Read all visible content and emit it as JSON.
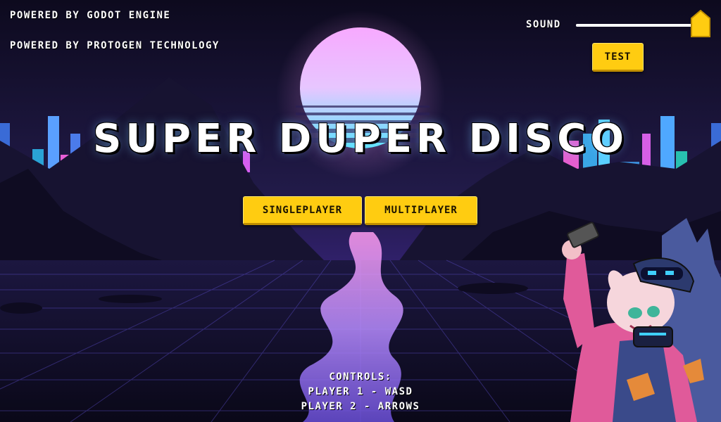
{
  "credits": {
    "line1": "POWERED BY GODOT ENGINE",
    "line2": "POWERED BY PROTOGEN TECHNOLOGY"
  },
  "sound": {
    "label": "SOUND",
    "level": 1.0,
    "test_label": "TEST"
  },
  "title": "SUPER DUPER DISCO",
  "menu": {
    "singleplayer_label": "SINGLEPLAYER",
    "multiplayer_label": "MULTIPLAYER"
  },
  "controls": {
    "title": "CONTROLS:",
    "player1": "PLAYER 1 - WASD",
    "player2": "PLAYER 2 - ARROWS"
  },
  "colors": {
    "button": "#ffcc11",
    "sun_top": "#f4a6ff",
    "sun_bottom": "#5ee6ff",
    "grid": "#6a5acd"
  }
}
